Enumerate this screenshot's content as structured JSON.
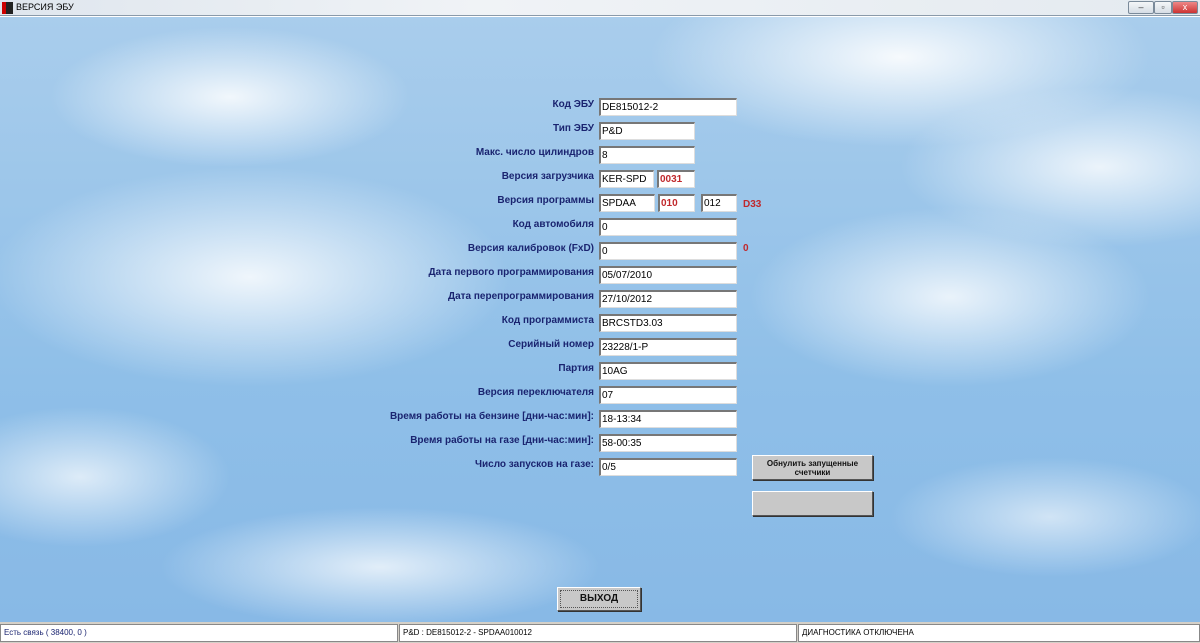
{
  "window": {
    "title": "ВЕРСИЯ ЭБУ",
    "min": "–",
    "max": "▫",
    "close": "x"
  },
  "fields": {
    "ecu_code": {
      "label": "Код ЭБУ",
      "value": "DE815012-2"
    },
    "ecu_type": {
      "label": "Тип ЭБУ",
      "value": "P&D"
    },
    "max_cyl": {
      "label": "Макс. число цилиндров",
      "value": "8"
    },
    "loader": {
      "label": "Версия загрузчика",
      "value": "KER-SPD",
      "value2": "0031"
    },
    "program": {
      "label": "Версия программы",
      "value": "SPDAA",
      "value2": "010",
      "value3": "012",
      "extra": "D33"
    },
    "car_code": {
      "label": "Код автомобиля",
      "value": "0"
    },
    "calib": {
      "label": "Версия калибровок (FxD)",
      "value": "0",
      "extra": "0"
    },
    "first_prog": {
      "label": "Дата первого программирования",
      "value": "05/07/2010"
    },
    "reprog": {
      "label": "Дата перепрограммирования",
      "value": "27/10/2012"
    },
    "programmer": {
      "label": "Код программиста",
      "value": "BRCSTD3.03"
    },
    "serial": {
      "label": "Серийный номер",
      "value": " 23228/1-P"
    },
    "batch": {
      "label": "Партия",
      "value": "10AG"
    },
    "switch_ver": {
      "label": "Версия переключателя",
      "value": "07"
    },
    "petrol_time": {
      "label": "Время работы на бензине [дни-час:мин]:",
      "value": "18-13:34"
    },
    "gas_time": {
      "label": "Время работы на газе [дни-час:мин]:",
      "value": "58-00:35"
    },
    "gas_starts": {
      "label": "Число запусков на газе:",
      "value": "0/5"
    }
  },
  "buttons": {
    "reset": "Обнулить запущенные счетчики",
    "exit": "ВЫХОД"
  },
  "status": {
    "connection": "Есть связь ( 38400,  0 )",
    "device": "P&D : DE815012-2 - SPDAA010012",
    "diag": "ДИАГНОСТИКА ОТКЛЮЧЕНА"
  }
}
